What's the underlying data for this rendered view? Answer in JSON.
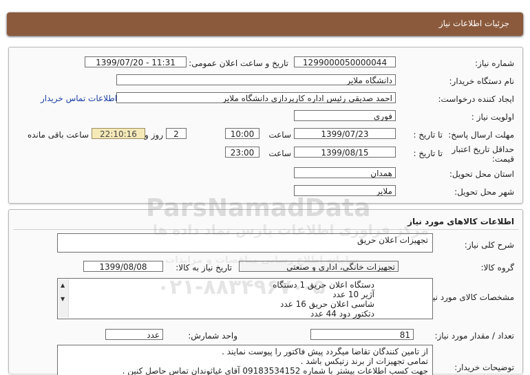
{
  "header": {
    "title": "جزئیات اطلاعات نیاز"
  },
  "need_info": {
    "need_number_label": "شماره نیاز:",
    "need_number": "1299000050000044",
    "announce_label": "تاریخ و ساعت اعلان عمومی:",
    "announce_value": "1399/07/20 - 11:31",
    "buyer_org_label": "نام دستگاه خریدار:",
    "buyer_org": "دانشگاه ملایر",
    "requester_label": "ایجاد کننده درخواست:",
    "requester": "احمد صدیقی رئیس اداره کارپردازی دانشگاه ملایر",
    "buyer_contact_link": "اطلاعات تماس خریدار",
    "priority_label": "اولویت نیاز :",
    "priority": "فوری",
    "deadline_label": "مهلت ارسال پاسخ:",
    "to_date_label": "تا تاریخ :",
    "deadline_date": "1399/07/23",
    "time_label": "ساعت",
    "deadline_time": "10:00",
    "days_value": "2",
    "days_label": "روز و",
    "remaining_time": "22:10:16",
    "remaining_label": "ساعت باقی مانده",
    "min_validity_label_1": "حداقل تاریخ اعتبار",
    "min_validity_label_2": "قیمت:",
    "validity_to_date_label": "تا تاریخ :",
    "validity_date": "1399/08/15",
    "validity_time_label": "ساعت",
    "validity_time": "23:00",
    "province_label": "استان محل تحویل:",
    "province": "همدان",
    "city_label": "شهر محل تحویل:",
    "city": "ملایر"
  },
  "goods": {
    "section_title": "اطلاعات کالاهای مورد نیاز",
    "general_desc_label": "شرح کلی نیاز:",
    "general_desc": "تجهیزات اعلان حریق",
    "group_label": "گروه کالا:",
    "group": "تجهیزات خانگی، اداری و صنعتی",
    "need_date_label": "تاریخ نیاز به کالا:",
    "need_date": "1399/08/08",
    "specs_label": "مشخصات کالای مورد نیاز:",
    "specs": [
      "دستگاه اعلان حریق 1 دستگاه",
      "آژیر 10 عدد",
      "شاسی اعلان حریق 16 عدد",
      "دتکتور دود 44 عدد"
    ],
    "qty_label": "تعداد / مقدار مورد نیاز:",
    "qty": "81",
    "unit_label": "واحد شمارش:",
    "unit": "عدد",
    "buyer_notes_label": "توضیحات خریدار:",
    "buyer_notes": [
      "از تامین کنندگان تقاضا میگردد پیش فاکتور را پیوست نمایند .",
      "تمامی تجهیزات از برند زتیکس باشد .",
      "جهت کسب اطلاعات بیشتر با شماره 09183534152 آقای غیاثوندان تماس حاصل کنین ."
    ]
  },
  "watermark": {
    "brand": "ParsNamadData",
    "persian": "مرکز فراوری اطلاعات پارس نماد داده ها",
    "persian2": "سامانه اطلاع رسانی مناقصات و مزایدات",
    "phone": "۰۲۱-۸۸۳۴۹۶۷۰-۵"
  },
  "colors": {
    "header": "#8b5a3c",
    "link": "#1a3fa6",
    "remaining_bg": "#f5e9b8"
  }
}
